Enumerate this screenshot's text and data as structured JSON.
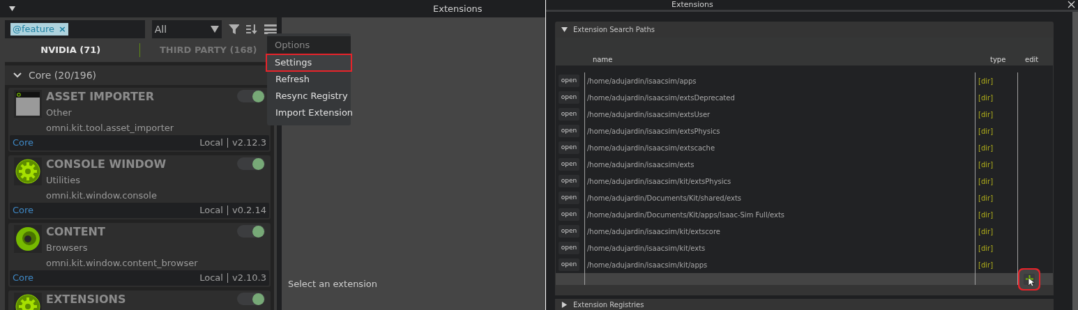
{
  "left_window": {
    "title": "Extensions",
    "search": {
      "tag": "@feature",
      "tag_remove": "×"
    },
    "filter_dropdown": {
      "value": "All"
    },
    "tabs": [
      {
        "label": "NVIDIA (71)",
        "selected": true
      },
      {
        "label": "THIRD PARTY (168)",
        "selected": false
      }
    ],
    "group": {
      "label": "Core (20/196)",
      "expanded": true
    },
    "extensions": [
      {
        "kind": "window",
        "name": "ASSET IMPORTER",
        "category": "Other",
        "id": "omni.kit.tool.asset_importer",
        "source": "Core",
        "location": "Local",
        "version": "v2.12.3",
        "enabled": true
      },
      {
        "kind": "gear",
        "name": "CONSOLE WINDOW",
        "category": "Utilities",
        "id": "omni.kit.window.console",
        "source": "Core",
        "location": "Local",
        "version": "v0.2.14",
        "enabled": true
      },
      {
        "kind": "ring",
        "name": "CONTENT",
        "category": "Browsers",
        "id": "omni.kit.window.content_browser",
        "source": "Core",
        "location": "Local",
        "version": "v2.10.3",
        "enabled": true
      },
      {
        "kind": "gear",
        "name": "EXTENSIONS",
        "enabled": true
      }
    ],
    "options_menu": {
      "title": "Options",
      "items": [
        {
          "label": "Settings",
          "highlighted": true
        },
        {
          "label": "Refresh",
          "highlighted": false
        },
        {
          "label": "Resync Registry",
          "highlighted": false
        },
        {
          "label": "Import Extension",
          "highlighted": false
        }
      ]
    },
    "details_message": "Select an extension"
  },
  "right_window": {
    "title": "Extensions",
    "search_paths": {
      "title": "Extension Search Paths",
      "expanded": true,
      "columns": [
        "name",
        "type",
        "edit"
      ],
      "rows": [
        {
          "button": "open",
          "path": "/home/adujardin/isaacsim/apps",
          "type": "[dir]"
        },
        {
          "button": "open",
          "path": "/home/adujardin/isaacsim/extsDeprecated",
          "type": "[dir]"
        },
        {
          "button": "open",
          "path": "/home/adujardin/isaacsim/extsUser",
          "type": "[dir]"
        },
        {
          "button": "open",
          "path": "/home/adujardin/isaacsim/extsPhysics",
          "type": "[dir]"
        },
        {
          "button": "open",
          "path": "/home/adujardin/isaacsim/extscache",
          "type": "[dir]"
        },
        {
          "button": "open",
          "path": "/home/adujardin/isaacsim/exts",
          "type": "[dir]"
        },
        {
          "button": "open",
          "path": "/home/adujardin/isaacsim/kit/extsPhysics",
          "type": "[dir]"
        },
        {
          "button": "open",
          "path": "/home/adujardin/Documents/Kit/shared/exts",
          "type": "[dir]"
        },
        {
          "button": "open",
          "path": "/home/adujardin/Documents/Kit/apps/Isaac-Sim Full/exts",
          "type": "[dir]"
        },
        {
          "button": "open",
          "path": "/home/adujardin/isaacsim/kit/extscore",
          "type": "[dir]"
        },
        {
          "button": "open",
          "path": "/home/adujardin/isaacsim/kit/exts",
          "type": "[dir]"
        },
        {
          "button": "open",
          "path": "/home/adujardin/isaacsim/kit/apps",
          "type": "[dir]"
        }
      ],
      "add_button": {
        "highlighted": true
      }
    },
    "registries": {
      "title": "Extension Registries",
      "expanded": false
    }
  }
}
